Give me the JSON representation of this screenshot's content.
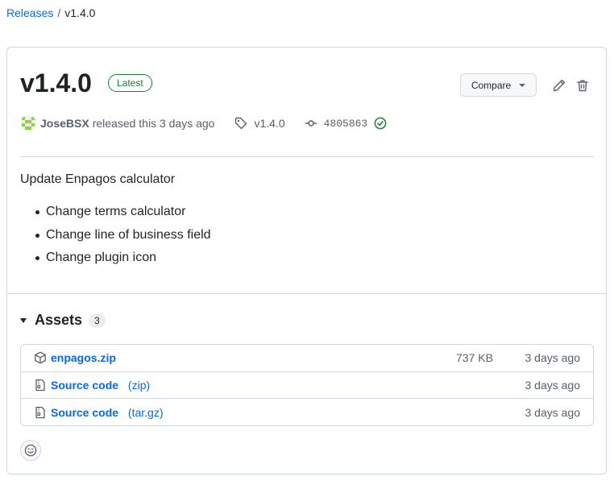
{
  "breadcrumb": {
    "root": "Releases",
    "separator": "/",
    "current": "v1.4.0"
  },
  "release": {
    "title": "v1.4.0",
    "badge": "Latest",
    "compare_label": "Compare",
    "author": "JoseBSX",
    "released_text": "released this 3 days ago",
    "tag": "v1.4.0",
    "commit": "4805863",
    "colors": {
      "accent": "#0969da",
      "success": "#1a7f37",
      "border": "#d0d7de",
      "muted": "#57606a"
    }
  },
  "notes": {
    "heading": "Update Enpagos calculator",
    "items": [
      "Change terms calculator",
      "Change line of business field",
      "Change plugin icon"
    ]
  },
  "assets": {
    "title": "Assets",
    "count": "3",
    "rows": [
      {
        "name": "enpagos.zip",
        "format": "",
        "size": "737 KB",
        "time": "3 days ago",
        "icon": "package-icon"
      },
      {
        "name": "Source code",
        "format": "(zip)",
        "size": "",
        "time": "3 days ago",
        "icon": "file-zip-icon"
      },
      {
        "name": "Source code",
        "format": "(tar.gz)",
        "size": "",
        "time": "3 days ago",
        "icon": "file-zip-icon"
      }
    ]
  }
}
